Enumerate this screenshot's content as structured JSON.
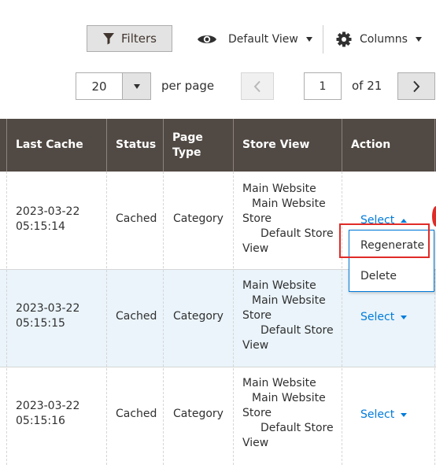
{
  "toolbar": {
    "filters_label": "Filters",
    "view_label": "Default View",
    "columns_label": "Columns"
  },
  "pager": {
    "per_page_value": "20",
    "per_page_label": "per page",
    "current_page": "1",
    "of_label": "of 21"
  },
  "columns": {
    "last_cache": "Last Cache",
    "status": "Status",
    "page_type_line1": "Page",
    "page_type_line2": "Type",
    "store_view": "Store View",
    "action": "Action"
  },
  "rows": [
    {
      "date": "2023-03-22",
      "time": "05:15:14",
      "status": "Cached",
      "page_type": "Category",
      "store": [
        "Main Website",
        "Main Website",
        "Store",
        "Default Store",
        "View"
      ],
      "action": "Select"
    },
    {
      "date": "2023-03-22",
      "time": "05:15:15",
      "status": "Cached",
      "page_type": "Category",
      "store": [
        "Main Website",
        "Main Website",
        "Store",
        "Default Store",
        "View"
      ],
      "action": "Select"
    },
    {
      "date": "2023-03-22",
      "time": "05:15:16",
      "status": "Cached",
      "page_type": "Category",
      "store": [
        "Main Website",
        "Main Website",
        "Store",
        "Default Store",
        "View"
      ],
      "action": "Select"
    }
  ],
  "action_menu": {
    "items": [
      "Regenerate",
      "Delete"
    ]
  },
  "colors": {
    "header_bg": "#514943",
    "link_blue": "#007bdb",
    "alt_row_bg": "#eaf4fa",
    "highlight_red": "#e02b27"
  }
}
